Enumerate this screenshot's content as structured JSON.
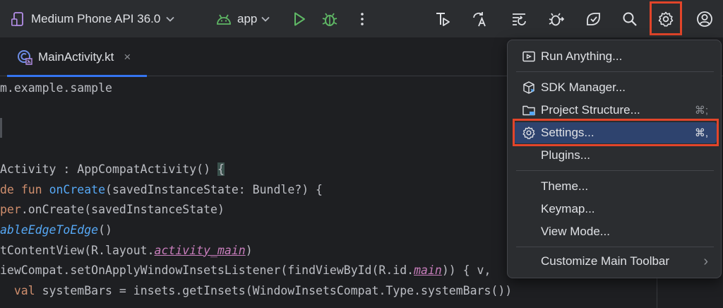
{
  "toolbar": {
    "device_label": "Medium Phone API 36.0",
    "run_config_label": "app",
    "colors": {
      "android_green": "#5fb865",
      "run_green": "#5fb865",
      "highlight_red": "#e2452a",
      "accent_blue": "#3574f0"
    },
    "right_icons": [
      "code-with-me-icon",
      "translate-icon",
      "apply-changes-icon",
      "debug-attach-icon",
      "device-mirroring-icon",
      "search-icon",
      "gear-icon",
      "profile-icon"
    ]
  },
  "tab": {
    "label": "MainActivity.kt",
    "close_glyph": "×"
  },
  "editor": {
    "lines": [
      [
        {
          "t": "m.example.sample",
          "c": "#bcbec4"
        }
      ],
      [],
      [],
      [],
      [
        {
          "t": "Activity : AppCompatActivity() ",
          "c": "#bcbec4"
        },
        {
          "t": "{",
          "c": "#bcbec4",
          "b": 1
        }
      ],
      [
        {
          "t": "de ",
          "c": "#cf8e6d"
        },
        {
          "t": "fun ",
          "c": "#cf8e6d"
        },
        {
          "t": "onCreate",
          "c": "#56a8f5"
        },
        {
          "t": "(savedInstanceState: Bundle?) {",
          "c": "#bcbec4"
        }
      ],
      [
        {
          "t": "per",
          "c": "#cf8e6d"
        },
        {
          "t": ".onCreate(savedInstanceState)",
          "c": "#bcbec4"
        }
      ],
      [
        {
          "t": "ableEdgeToEdge",
          "c": "#56a8f5",
          "i": 1
        },
        {
          "t": "()",
          "c": "#bcbec4"
        }
      ],
      [
        {
          "t": "tContentView(R.layout.",
          "c": "#bcbec4"
        },
        {
          "t": "activity_main",
          "c": "#c77dbb",
          "i": 1,
          "u": 1
        },
        {
          "t": ")",
          "c": "#bcbec4"
        }
      ],
      [
        {
          "t": "iewCompat.setOnApplyWindowInsetsListener(findViewById(R.id.",
          "c": "#bcbec4"
        },
        {
          "t": "main",
          "c": "#c77dbb",
          "i": 1,
          "u": 1
        },
        {
          "t": ")) { v,",
          "c": "#bcbec4"
        }
      ],
      [
        {
          "t": "  ",
          "c": "#bcbec4"
        },
        {
          "t": "val ",
          "c": "#cf8e6d"
        },
        {
          "t": "systemBars = insets.getInsets(WindowInsetsCompat.Type.systemBars())",
          "c": "#bcbec4"
        }
      ]
    ]
  },
  "menu": {
    "items": [
      {
        "label": "Run Anything...",
        "icon": "run-anything-icon",
        "shortcut": ""
      },
      {
        "label": "SDK Manager...",
        "icon": "sdk-manager-icon",
        "shortcut": ""
      },
      {
        "label": "Project Structure...",
        "icon": "project-structure-icon",
        "shortcut": "⌘;"
      },
      {
        "label": "Settings...",
        "icon": "gear-icon",
        "shortcut": "⌘,"
      },
      {
        "label": "Plugins...",
        "icon": "",
        "shortcut": ""
      },
      {
        "label": "Theme...",
        "icon": "",
        "shortcut": ""
      },
      {
        "label": "Keymap...",
        "icon": "",
        "shortcut": ""
      },
      {
        "label": "View Mode...",
        "icon": "",
        "shortcut": ""
      },
      {
        "label": "Customize Main Toolbar",
        "icon": "",
        "shortcut": "",
        "submenu_glyph": "›"
      }
    ],
    "selected_label": "Settings..."
  }
}
